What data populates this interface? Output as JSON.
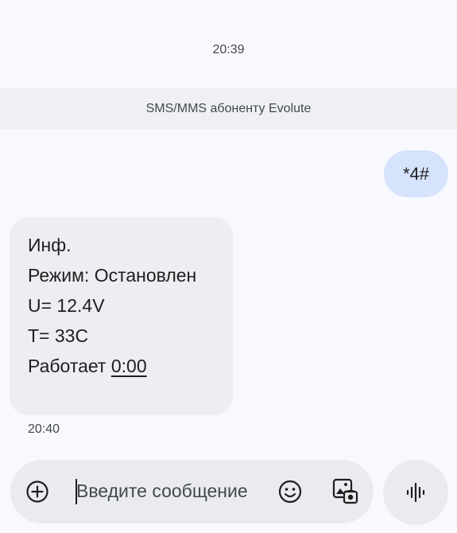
{
  "conversation": {
    "top_timestamp": "20:39",
    "banner_text": "SMS/MMS абоненту Evolute"
  },
  "outgoing_message": {
    "text": "*4#"
  },
  "incoming_message": {
    "lines": [
      "Инф.",
      "Режим: Остановлен",
      "U= 12.4V",
      "T= 33C"
    ],
    "last_line_prefix": "Работает ",
    "last_line_link": "0:00",
    "timestamp": "20:40"
  },
  "composer": {
    "placeholder": "Введите сообщение",
    "icons": [
      "add-icon",
      "emoji-icon",
      "gallery-icon",
      "voice-waveform-icon"
    ]
  },
  "colors": {
    "background": "#f8f9fe",
    "outgoing_bubble": "#d6e3fc",
    "incoming_bubble": "#eceef2",
    "banner": "#eef0f4",
    "composer": "#e9ebef"
  }
}
